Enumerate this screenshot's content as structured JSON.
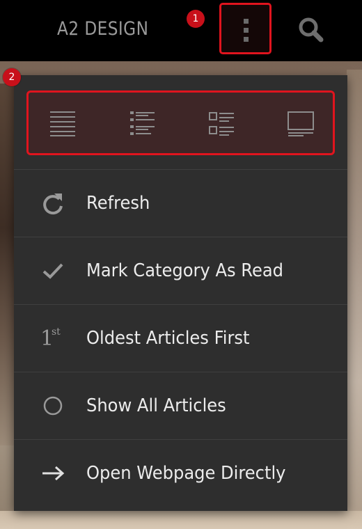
{
  "app": {
    "title": "A2 DESIGN"
  },
  "annotations": {
    "badge_1": "1",
    "badge_2": "2"
  },
  "toolbar": {
    "overflow_icon": "more-vertical-icon",
    "search_icon": "search-icon"
  },
  "view_modes": [
    {
      "icon": "list-dense-icon"
    },
    {
      "icon": "list-bulleted-icon"
    },
    {
      "icon": "list-thumbnail-icon"
    },
    {
      "icon": "card-view-icon"
    }
  ],
  "menu": {
    "items": [
      {
        "label": "Refresh",
        "icon": "refresh-icon"
      },
      {
        "label": "Mark Category As Read",
        "icon": "check-icon"
      },
      {
        "label": "Oldest Articles First",
        "icon": "first-icon",
        "icon_text": "1",
        "icon_sup": "st"
      },
      {
        "label": "Show All Articles",
        "icon": "circle-icon"
      },
      {
        "label": "Open Webpage Directly",
        "icon": "arrow-right-icon"
      }
    ]
  },
  "colors": {
    "highlight": "#e0141e",
    "badge": "#c8101a",
    "menu_bg": "#2e2e2e",
    "appbar_bg": "#000000"
  }
}
